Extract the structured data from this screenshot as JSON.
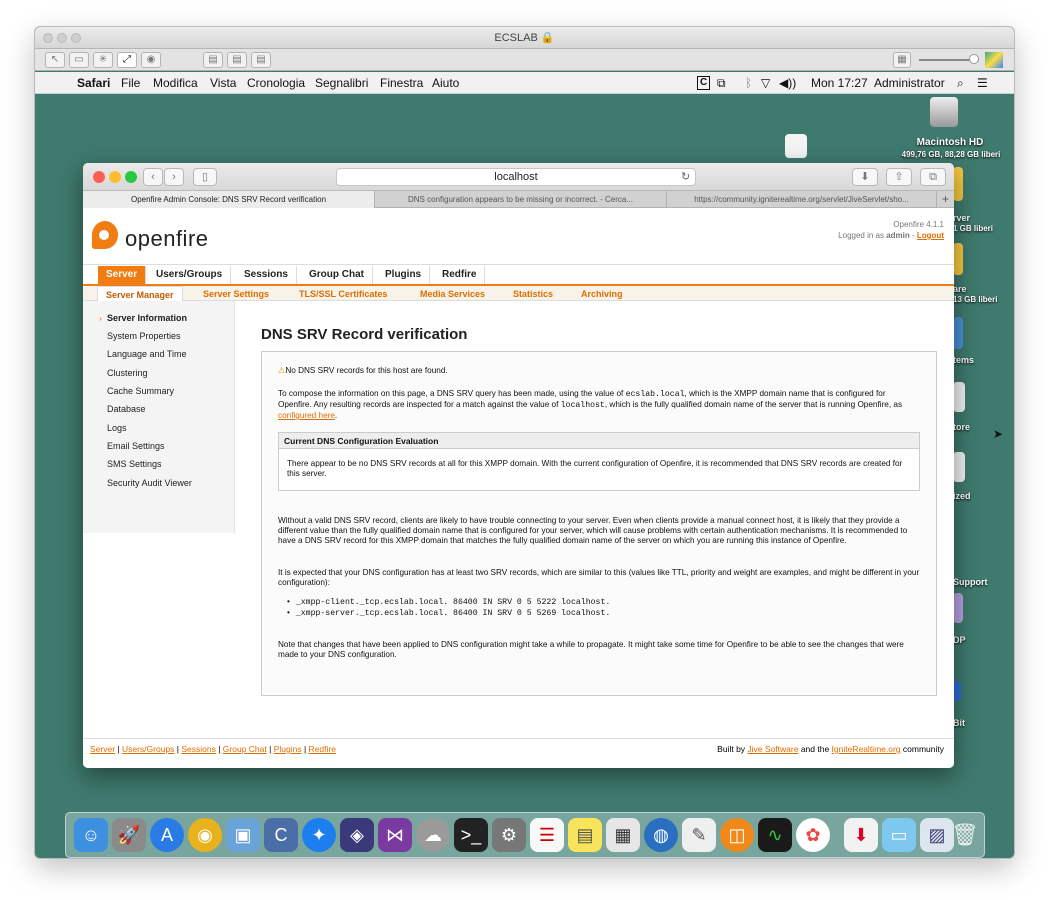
{
  "vm_window": {
    "title": "ECSLAB",
    "lock_icon": "lock-icon"
  },
  "menubar": {
    "apple": "",
    "items": [
      "Safari",
      "File",
      "Modifica",
      "Vista",
      "Cronologia",
      "Segnalibri",
      "Finestra",
      "Aiuto"
    ],
    "clock": "Mon 17:27",
    "user": "Administrator"
  },
  "desktop": {
    "hd_name": "Macintosh HD",
    "hd_info": "499,76 GB, 88,28 GB liberi",
    "partial_labels": [
      "rver",
      "1 GB liberi",
      "are",
      "13 GB liberi",
      "tems",
      "tore",
      "ized",
      "Support",
      "DP",
      "Bit"
    ]
  },
  "safari": {
    "url": "localhost",
    "tabs": [
      "Openfire Admin Console: DNS SRV Record verification",
      "DNS configuration appears to be missing or incorrect. - Cerca...",
      "https://community.igniterealtime.org/servlet/JiveServlet/sho..."
    ]
  },
  "openfire": {
    "logo_text": "openfire",
    "version": "Openfire 4.1.1",
    "logged_in_prefix": "Logged in as ",
    "user": "admin",
    "logout": "Logout",
    "main_tabs": [
      "Server",
      "Users/Groups",
      "Sessions",
      "Group Chat",
      "Plugins",
      "Redfire"
    ],
    "sub_tabs": [
      "Server Manager",
      "Server Settings",
      "TLS/SSL Certificates",
      "Media Services",
      "Statistics",
      "Archiving"
    ],
    "sidebar": [
      "Server Information",
      "System Properties",
      "Language and Time",
      "Clustering",
      "Cache Summary",
      "Database",
      "Logs",
      "Email Settings",
      "SMS Settings",
      "Security Audit Viewer"
    ],
    "page_title": "DNS SRV Record verification",
    "warning": "No DNS SRV records for this host are found.",
    "intro_1": "To compose the information on this page, a DNS SRV query has been made, using the value of ",
    "domain": "ecslab.local",
    "intro_2": ", which is the XMPP domain name that is configured for Openfire. Any resulting records are inspected for a match against the value of ",
    "host": "localhost",
    "intro_3": ", which is the fully qualified domain name of the server that is running Openfire, as ",
    "configured_link": "configured here",
    "intro_4": ".",
    "eval_heading": "Current DNS Configuration Evaluation",
    "eval_text": "There appear to be no DNS SRV records at all for this XMPP domain. With the current configuration of Openfire, it is recommended that DNS SRV records are created for this server.",
    "para_without": "Without a valid DNS SRV record, clients are likely to have trouble connecting to your server. Even when clients provide a manual connect host, it is likely that they provide a different value than the fully qualified domain name that is configured for your server, which will cause problems with certain authentication mechanisms. It is recommended to have a DNS SRV record for this XMPP domain that matches the fully qualified domain name of the server on which you are running this instance of Openfire.",
    "para_expected": "It is expected that your DNS configuration has at least two SRV records, which are similar to this (values like TTL, priority and weight are examples, and might be different in your configuration):",
    "srv_records": [
      "_xmpp-client._tcp.ecslab.local. 86400 IN SRV 0 5 5222 localhost.",
      "_xmpp-server._tcp.ecslab.local. 86400 IN SRV 0 5 5269 localhost."
    ],
    "para_note": "Note that changes that have been applied to DNS configuration might take a while to propagate. It might take some time for Openfire to be able to see the changes that were made to your DNS configuration.",
    "footer_links": [
      "Server",
      "Users/Groups",
      "Sessions",
      "Group Chat",
      "Plugins",
      "Redfire"
    ],
    "footer_built_by": "Built by ",
    "footer_jive": "Jive Software",
    "footer_and": " and the ",
    "footer_ignite": "IgniteRealtime.org",
    "footer_community": " community"
  }
}
